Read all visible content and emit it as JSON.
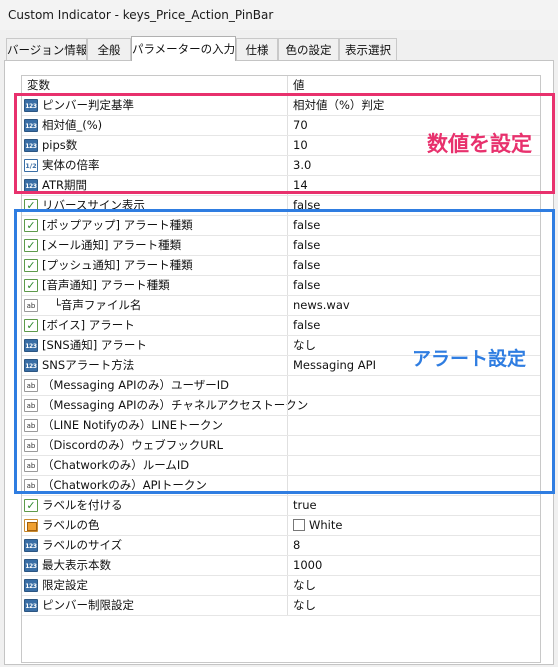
{
  "window": {
    "title": "Custom Indicator - keys_Price_Action_PinBar"
  },
  "tabs": [
    {
      "label": "バージョン情報",
      "active": false
    },
    {
      "label": "全般",
      "active": false
    },
    {
      "label": "パラメーターの入力",
      "active": true
    },
    {
      "label": "仕様",
      "active": false
    },
    {
      "label": "色の設定",
      "active": false
    },
    {
      "label": "表示選択",
      "active": false
    }
  ],
  "grid": {
    "col_variable": "変数",
    "col_value": "値",
    "rows": [
      {
        "name": "ピンバー判定基準",
        "value": "相対値（%）判定",
        "icon": "number-icon"
      },
      {
        "name": "相対値_(%)",
        "value": "70",
        "icon": "number-icon"
      },
      {
        "name": "pips数",
        "value": "10",
        "icon": "number-icon"
      },
      {
        "name": "実体の倍率",
        "value": "3.0",
        "icon": "double-icon"
      },
      {
        "name": "ATR期間",
        "value": "14",
        "icon": "number-icon"
      },
      {
        "name": "リバースサイン表示",
        "value": "false",
        "icon": "bool-icon"
      },
      {
        "name": "[ポップアップ] アラート種類",
        "value": "false",
        "icon": "bool-icon"
      },
      {
        "name": "[メール通知] アラート種類",
        "value": "false",
        "icon": "bool-icon"
      },
      {
        "name": "[プッシュ通知] アラート種類",
        "value": "false",
        "icon": "bool-icon"
      },
      {
        "name": "[音声通知] アラート種類",
        "value": "false",
        "icon": "bool-icon"
      },
      {
        "name": "└音声ファイル名",
        "value": "news.wav",
        "icon": "string-icon"
      },
      {
        "name": "[ボイス] アラート",
        "value": "false",
        "icon": "bool-icon"
      },
      {
        "name": "[SNS通知] アラート",
        "value": "なし",
        "icon": "number-icon"
      },
      {
        "name": "SNSアラート方法",
        "value": "Messaging API",
        "icon": "number-icon"
      },
      {
        "name": "（Messaging APIのみ）ユーザーID",
        "value": "",
        "icon": "string-icon"
      },
      {
        "name": "（Messaging APIのみ）チャネルアクセストークン",
        "value": "",
        "icon": "string-icon"
      },
      {
        "name": "（LINE Notifyのみ）LINEトークン",
        "value": "",
        "icon": "string-icon"
      },
      {
        "name": "（Discordのみ）ウェブフックURL",
        "value": "",
        "icon": "string-icon"
      },
      {
        "name": "（Chatworkのみ）ルームID",
        "value": "",
        "icon": "string-icon"
      },
      {
        "name": "（Chatworkのみ）APIトークン",
        "value": "",
        "icon": "string-icon"
      },
      {
        "name": "ラベルを付ける",
        "value": "true",
        "icon": "bool-icon"
      },
      {
        "name": "ラベルの色",
        "value": "White",
        "icon": "color-icon"
      },
      {
        "name": "ラベルのサイズ",
        "value": "8",
        "icon": "number-icon"
      },
      {
        "name": "最大表示本数",
        "value": "1000",
        "icon": "number-icon"
      },
      {
        "name": "限定設定",
        "value": "なし",
        "icon": "number-icon"
      },
      {
        "name": "ピンバー制限設定",
        "value": "なし",
        "icon": "number-icon"
      }
    ]
  },
  "icon_glyphs": {
    "number": "123",
    "double": "1/2",
    "bool": "✓",
    "string": "ab"
  },
  "annotations": {
    "numeric": "数値を設定",
    "alert": "アラート設定",
    "numeric_color": "#e8316d",
    "alert_color": "#2f7de1"
  }
}
